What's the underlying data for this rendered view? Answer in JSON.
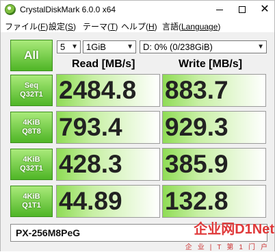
{
  "title": "CrystalDiskMark 6.0.0 x64",
  "menu": [
    {
      "label": "ファイル(",
      "key": "F",
      "end": ")"
    },
    {
      "label": "設定(",
      "key": "S",
      "end": ")"
    },
    {
      "label": "テーマ(",
      "key": "T",
      "end": ")"
    },
    {
      "label": "ヘルプ(",
      "key": "H",
      "end": ")"
    },
    {
      "label": "言語(",
      "key": "Language",
      "end": ")"
    }
  ],
  "controls": {
    "all_label": "All",
    "count": "5",
    "size": "1GiB",
    "drive": "D: 0% (0/238GiB)"
  },
  "headers": {
    "read": "Read [MB/s]",
    "write": "Write [MB/s]"
  },
  "rows": [
    {
      "label1": "Seq",
      "label2": "Q32T1",
      "read": "2484.8",
      "write": "883.7"
    },
    {
      "label1": "4KiB",
      "label2": "Q8T8",
      "read": "793.4",
      "write": "929.3"
    },
    {
      "label1": "4KiB",
      "label2": "Q32T1",
      "read": "428.3",
      "write": "385.9"
    },
    {
      "label1": "4KiB",
      "label2": "Q1T1",
      "read": "44.89",
      "write": "132.8"
    }
  ],
  "comment": "PX-256M8PeG",
  "watermark": {
    "main": "企业网D1Net",
    "sub": "企业|T第1门户"
  },
  "colors": {
    "accent_green": "#4fb526",
    "watermark_red": "#e0393a"
  }
}
